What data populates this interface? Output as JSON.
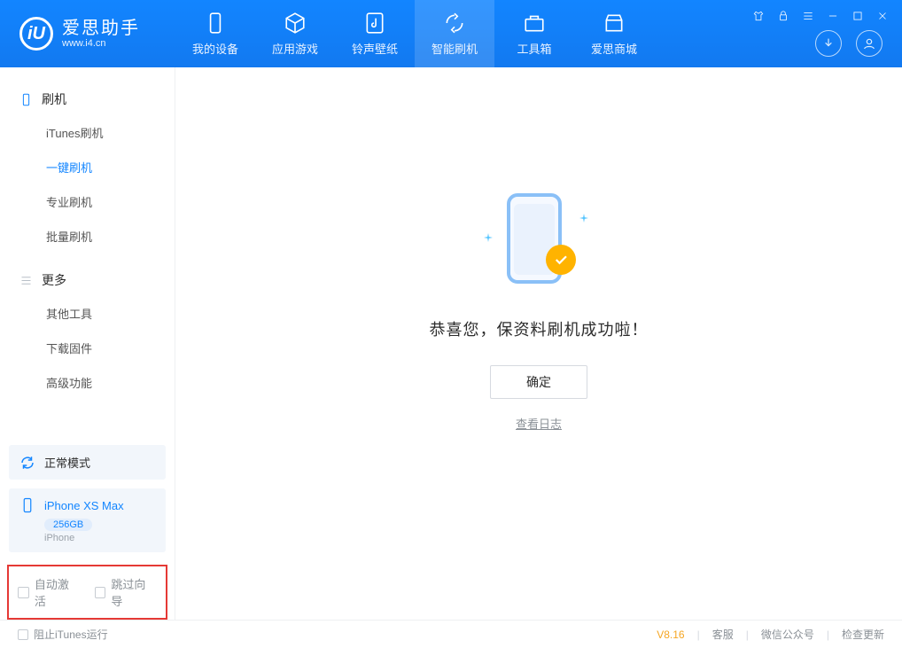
{
  "brand": {
    "title": "爱思助手",
    "url": "www.i4.cn",
    "logo_letter": "iU"
  },
  "nav": [
    {
      "label": "我的设备",
      "icon": "device"
    },
    {
      "label": "应用游戏",
      "icon": "cube"
    },
    {
      "label": "铃声壁纸",
      "icon": "music"
    },
    {
      "label": "智能刷机",
      "icon": "refresh",
      "active": true
    },
    {
      "label": "工具箱",
      "icon": "toolbox"
    },
    {
      "label": "爱思商城",
      "icon": "store"
    }
  ],
  "sidebar": {
    "group1": {
      "title": "刷机",
      "items": [
        "iTunes刷机",
        "一键刷机",
        "专业刷机",
        "批量刷机"
      ],
      "selected": 1
    },
    "group2": {
      "title": "更多",
      "items": [
        "其他工具",
        "下载固件",
        "高级功能"
      ]
    }
  },
  "mode_label": "正常模式",
  "device": {
    "name": "iPhone XS Max",
    "capacity": "256GB",
    "type": "iPhone"
  },
  "options": {
    "auto_activate": "自动激活",
    "skip_guide": "跳过向导"
  },
  "main": {
    "message": "恭喜您，保资料刷机成功啦！",
    "ok": "确定",
    "view_log": "查看日志"
  },
  "footer": {
    "block_itunes": "阻止iTunes运行",
    "version": "V8.16",
    "support": "客服",
    "wechat": "微信公众号",
    "check_update": "检查更新"
  }
}
